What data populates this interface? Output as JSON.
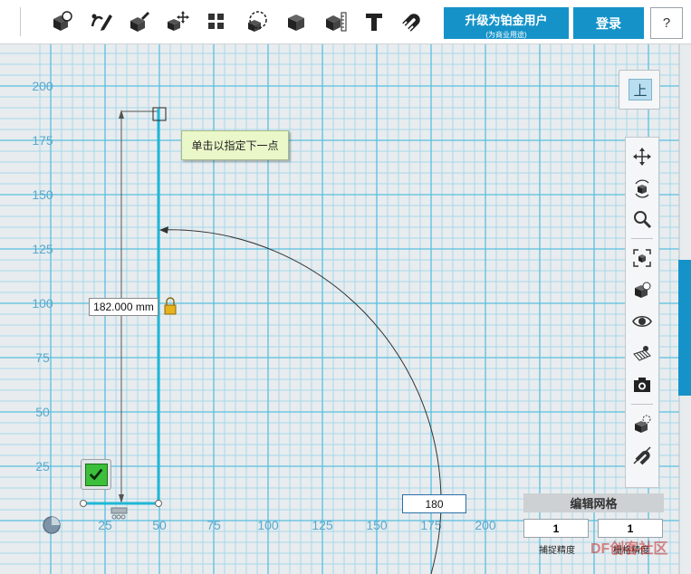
{
  "toolbar": {
    "tools": [
      {
        "name": "primitives-tool",
        "icon": "cube-shapes-icon"
      },
      {
        "name": "sketch-tool",
        "icon": "pencil-curve-icon"
      },
      {
        "name": "construct-tool",
        "icon": "cube-pencil-icon"
      },
      {
        "name": "modify-tool",
        "icon": "cube-move-icon"
      },
      {
        "name": "pattern-tool",
        "icon": "cube-grid-icon"
      },
      {
        "name": "grouping-tool",
        "icon": "cube-group-icon"
      },
      {
        "name": "combine-tool",
        "icon": "cube-solid-icon"
      },
      {
        "name": "measure-tool",
        "icon": "cube-ruler-icon"
      },
      {
        "name": "text-tool",
        "icon": "text-t-icon"
      },
      {
        "name": "snap-tool",
        "icon": "magnet-icon"
      }
    ],
    "upgrade_label": "升级为铂金用户",
    "upgrade_sub": "(为商业用途)",
    "login_label": "登录",
    "help_label": "?"
  },
  "viewcube": {
    "face_label": "上"
  },
  "navbar": {
    "items": [
      {
        "name": "pan",
        "icon": "pan-arrows-icon"
      },
      {
        "name": "orbit",
        "icon": "orbit-cube-icon"
      },
      {
        "name": "zoom",
        "icon": "zoom-magnifier-icon"
      },
      {
        "name": "fit",
        "icon": "fit-view-icon"
      },
      {
        "name": "view-solid",
        "icon": "solid-view-icon"
      },
      {
        "name": "visibility",
        "icon": "eye-icon"
      },
      {
        "name": "grid-visibility",
        "icon": "grid-eye-icon"
      },
      {
        "name": "screenshot",
        "icon": "camera-icon"
      },
      {
        "name": "material",
        "icon": "material-cube-icon"
      },
      {
        "name": "snap-toggle",
        "icon": "snap-slash-icon"
      }
    ]
  },
  "sketch": {
    "tooltip": "单击以指定下一点",
    "length_value": "182.000 mm",
    "angle_value": "180"
  },
  "axes": {
    "x_ticks": [
      "25",
      "50",
      "75",
      "100",
      "125",
      "150",
      "175",
      "200"
    ],
    "y_ticks": [
      "200",
      "175",
      "150",
      "125",
      "100",
      "75",
      "50",
      "25"
    ]
  },
  "grid_panel": {
    "title": "编辑网格",
    "minor_value": "1",
    "major_value": "1",
    "minor_label": "捕捉精度",
    "major_label": "栅格精度"
  },
  "colors": {
    "accent": "#1593c9",
    "grid_major": "#58bfe0",
    "grid_minor": "#a6d8ea",
    "sketch": "#1fb7d6"
  },
  "watermark": "DF创客社区"
}
